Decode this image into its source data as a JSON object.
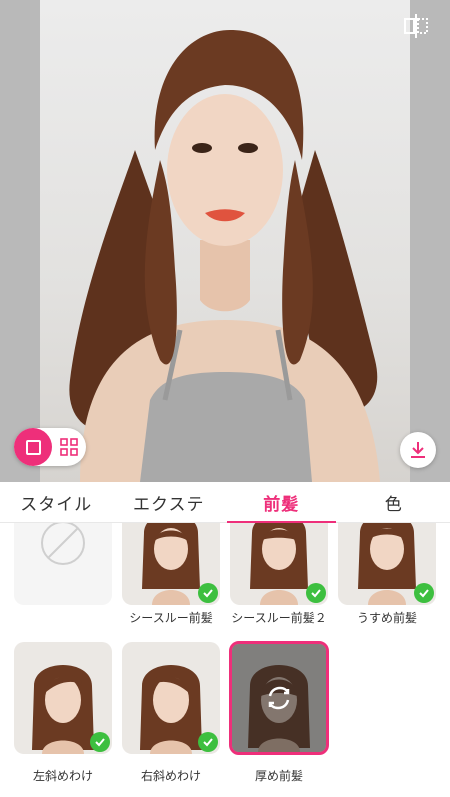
{
  "tabs": [
    {
      "label": "スタイル",
      "active": false
    },
    {
      "label": "エクステ",
      "active": false
    },
    {
      "label": "前髪",
      "active": true
    },
    {
      "label": "色",
      "active": false
    }
  ],
  "styles": [
    {
      "label": "",
      "state": "none"
    },
    {
      "label": "シースルー前髪",
      "state": "downloaded"
    },
    {
      "label": "シースルー前髪２",
      "state": "downloaded"
    },
    {
      "label": "うすめ前髪",
      "state": "downloaded"
    },
    {
      "label": "左斜めわけ",
      "state": "downloaded"
    },
    {
      "label": "右斜めわけ",
      "state": "downloaded"
    },
    {
      "label": "厚め前髪",
      "state": "selected"
    }
  ],
  "colors": {
    "accent": "#ee2f7a",
    "check": "#3dbf3f",
    "hair": "#6b3a22"
  },
  "icons": {
    "compare": "split-compare-icon",
    "single_view": "single-square-icon",
    "grid_view": "grid-2x2-icon",
    "download": "download-arrow-icon",
    "none": "none-slash-icon",
    "refresh": "refresh-cycle-icon",
    "check": "check-icon"
  }
}
